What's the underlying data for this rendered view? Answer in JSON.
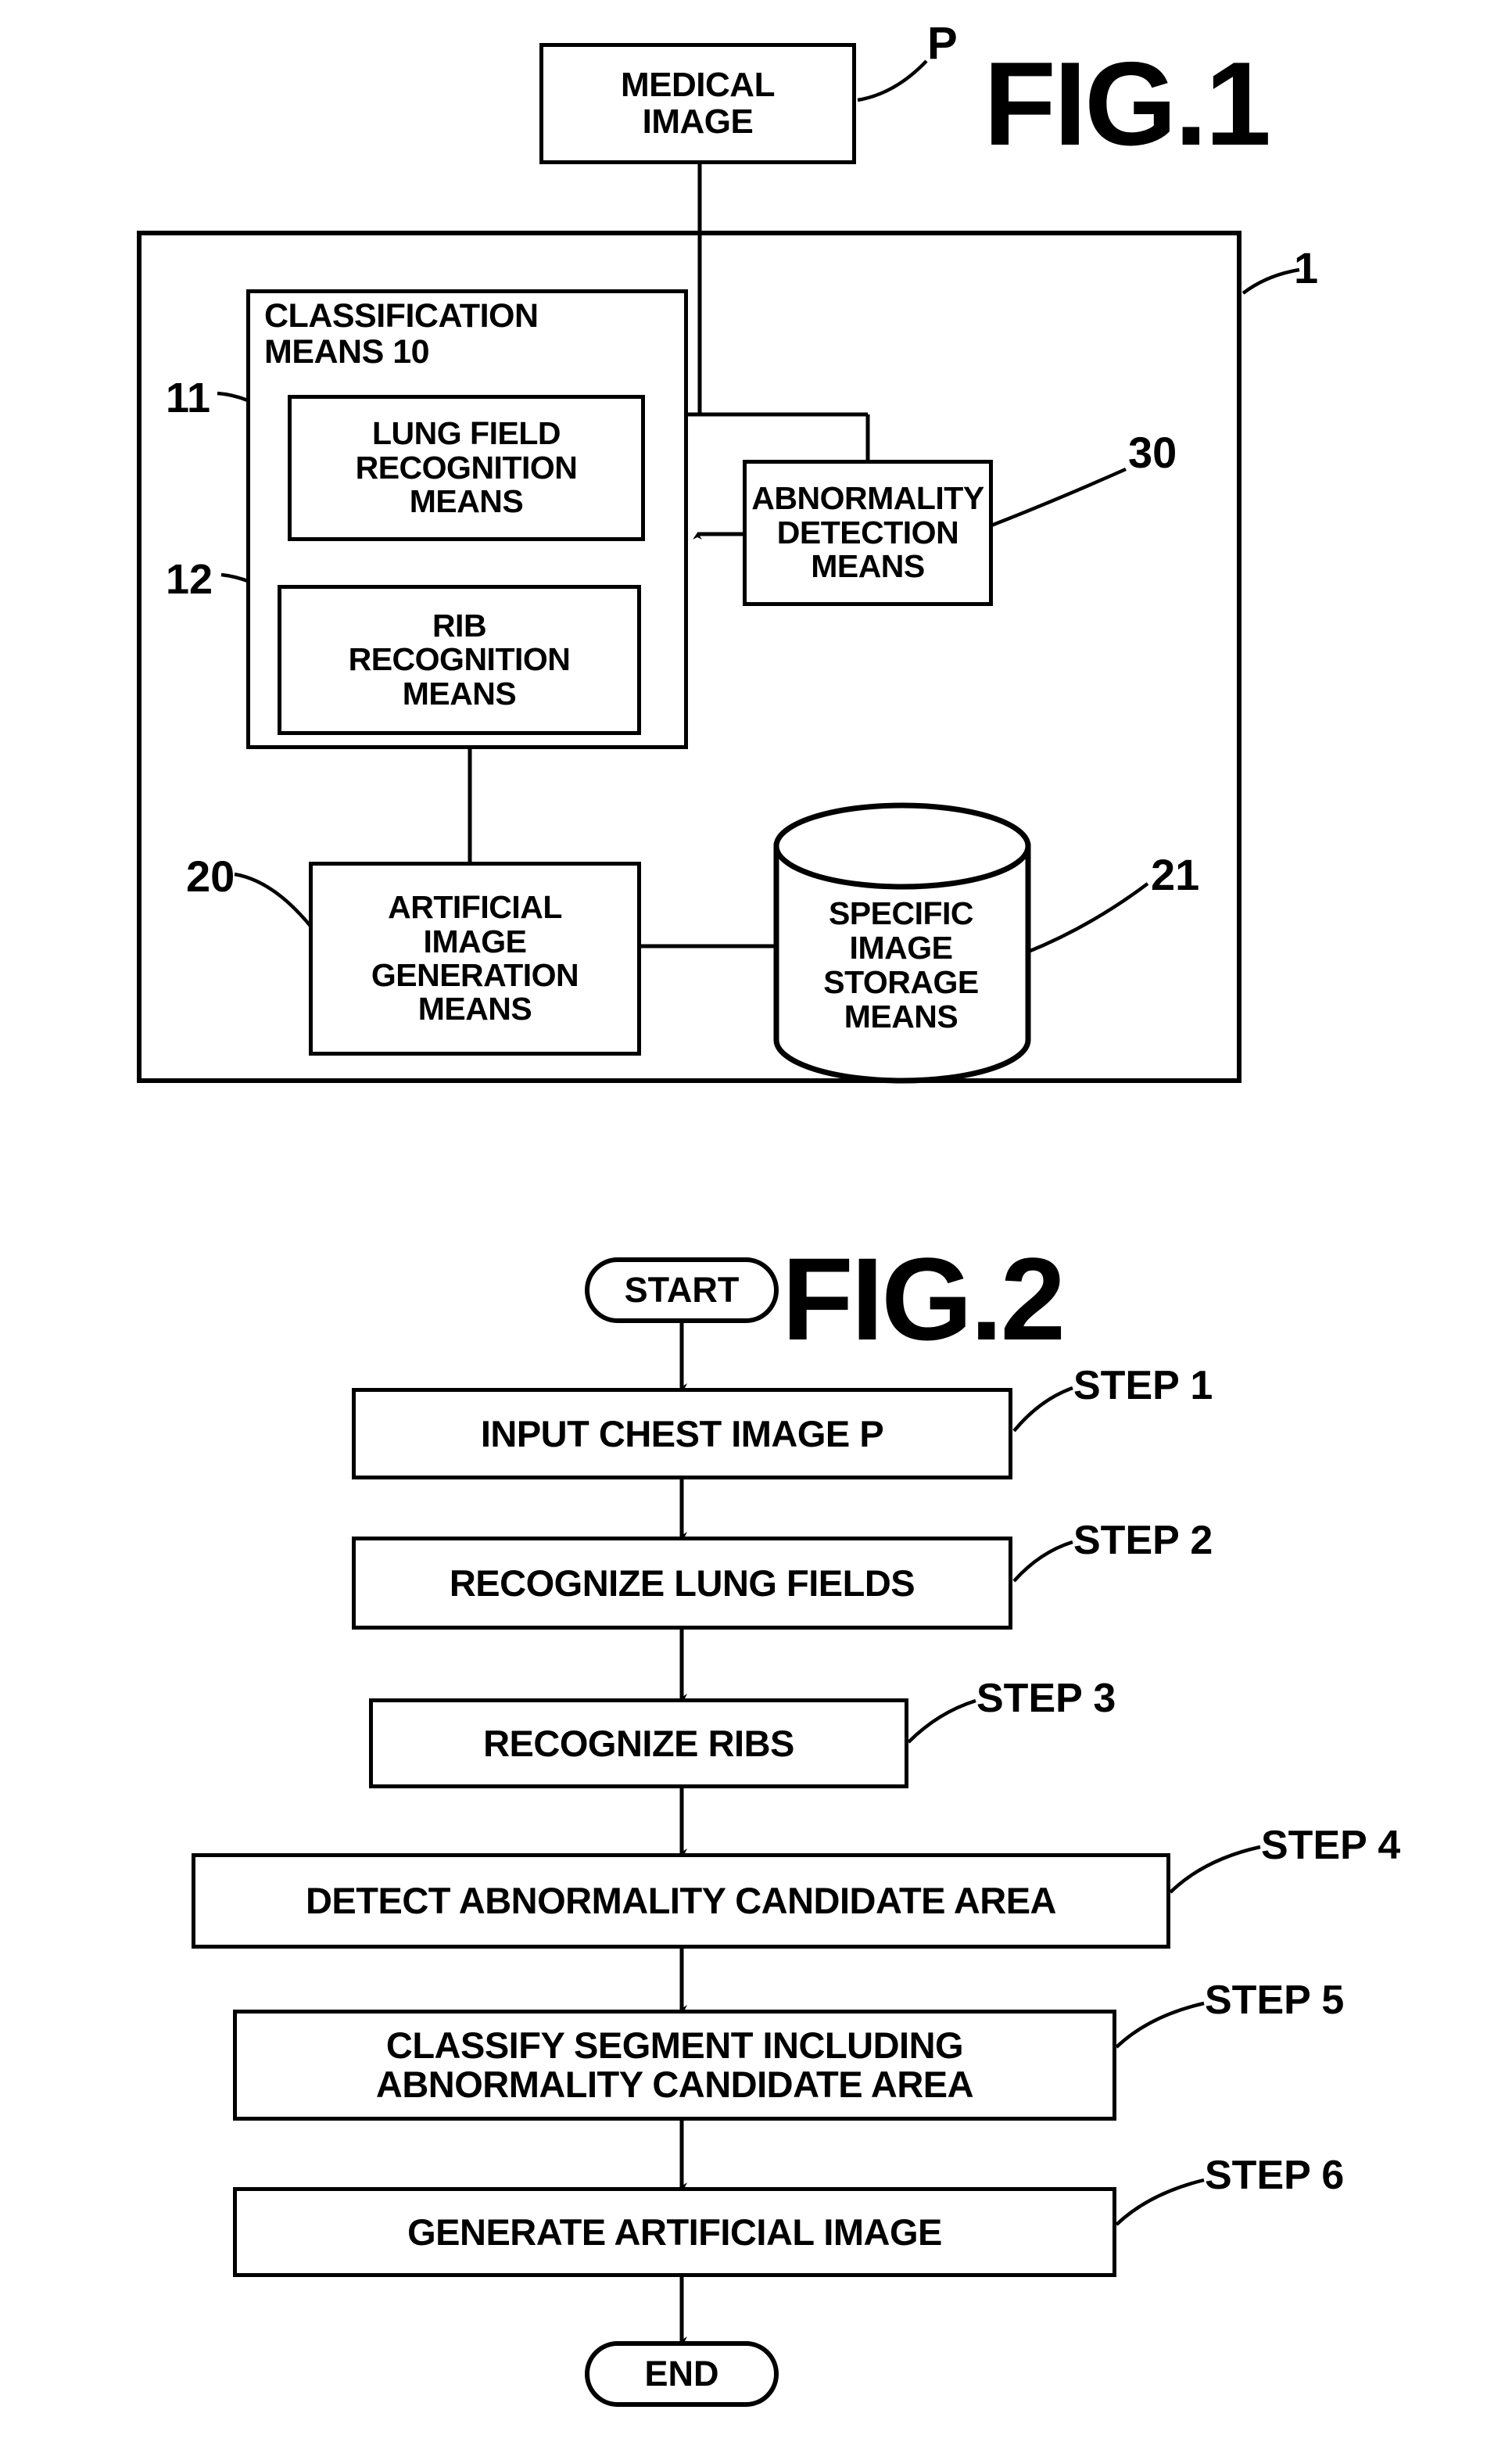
{
  "figure1": {
    "title": "FIG.1",
    "source_box": {
      "label": "MEDICAL\nIMAGE",
      "line1": "MEDICAL",
      "line2": "IMAGE",
      "ref": "P"
    },
    "system_ref": "1",
    "classification_means": {
      "title_line1": "CLASSIFICATION",
      "title_line2": "MEANS 10",
      "children": [
        {
          "ref": "11",
          "line1": "LUNG FIELD",
          "line2": "RECOGNITION",
          "line3": "MEANS"
        },
        {
          "ref": "12",
          "line1": "RIB",
          "line2": "RECOGNITION",
          "line3": "MEANS"
        }
      ]
    },
    "abnormality_detection": {
      "ref": "30",
      "line1": "ABNORMALITY",
      "line2": "DETECTION",
      "line3": "MEANS"
    },
    "artificial_image_generation": {
      "ref": "20",
      "line1": "ARTIFICIAL",
      "line2": "IMAGE",
      "line3": "GENERATION",
      "line4": "MEANS"
    },
    "specific_image_storage": {
      "ref": "21",
      "line1": "SPECIFIC",
      "line2": "IMAGE",
      "line3": "STORAGE",
      "line4": "MEANS"
    }
  },
  "figure2": {
    "title": "FIG.2",
    "start_label": "START",
    "end_label": "END",
    "steps": [
      {
        "ref": "STEP 1",
        "text": "INPUT CHEST IMAGE P"
      },
      {
        "ref": "STEP 2",
        "text": "RECOGNIZE LUNG FIELDS"
      },
      {
        "ref": "STEP 3",
        "text": "RECOGNIZE RIBS"
      },
      {
        "ref": "STEP 4",
        "text": "DETECT ABNORMALITY CANDIDATE AREA"
      },
      {
        "ref": "STEP 5",
        "line1": "CLASSIFY SEGMENT INCLUDING",
        "line2": "ABNORMALITY CANDIDATE AREA"
      },
      {
        "ref": "STEP 6",
        "text": "GENERATE ARTIFICIAL IMAGE"
      }
    ]
  },
  "colors": {
    "ink": "#000000",
    "paper": "#ffffff"
  }
}
